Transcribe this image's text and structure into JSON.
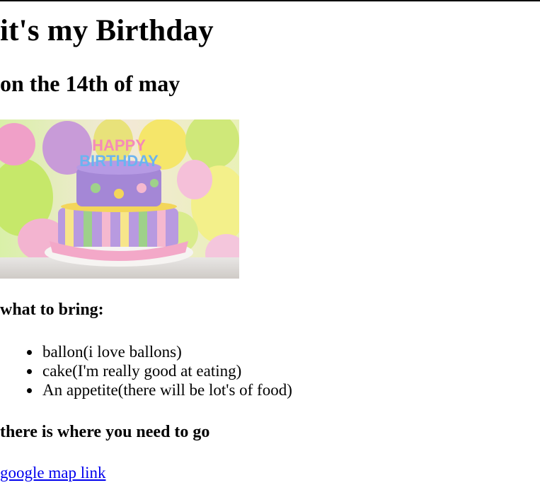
{
  "page": {
    "title": "it's my Birthday",
    "subtitle": "on the 14th of may"
  },
  "image": {
    "description_icon": "birthday-cake-photo",
    "topper_line1": "HAPPY",
    "topper_line2": "BIRTHDAY"
  },
  "bring": {
    "heading": "what to bring:",
    "items": [
      "ballon(i love ballons)",
      "cake(I'm really good at eating)",
      "An appetite(there will be lot's of food)"
    ]
  },
  "directions": {
    "heading": "there is where you need to go",
    "link_text": "google map link"
  },
  "colors": {
    "link": "#0000ee",
    "text": "#000000",
    "background": "#ffffff"
  }
}
